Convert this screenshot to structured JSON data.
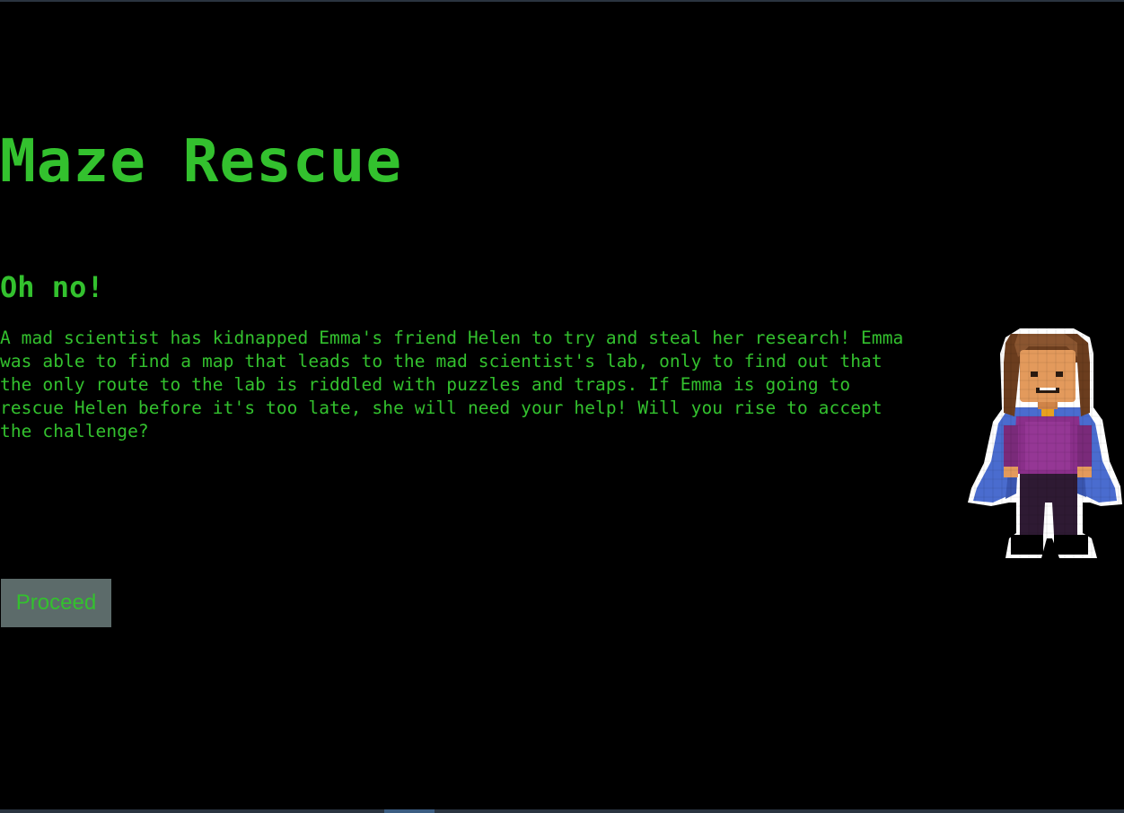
{
  "game": {
    "title": "Maze Rescue",
    "heading": "Oh no!",
    "story": "A mad scientist has kidnapped Emma's friend Helen to try and steal her research! Emma\nwas able to find a map that leads to the mad scientist's lab, only to find out that\nthe only route to the lab is riddled with puzzles and traps. If Emma is going to\nrescue Helen before it's too late, she will need your help! Will you rise to accept\nthe challenge?",
    "proceed_label": "Proceed"
  },
  "colors": {
    "background": "#000000",
    "text": "#33c12e",
    "button_bg": "#5c6b6a"
  },
  "character": {
    "icon": "emma-pixel-character-icon"
  }
}
